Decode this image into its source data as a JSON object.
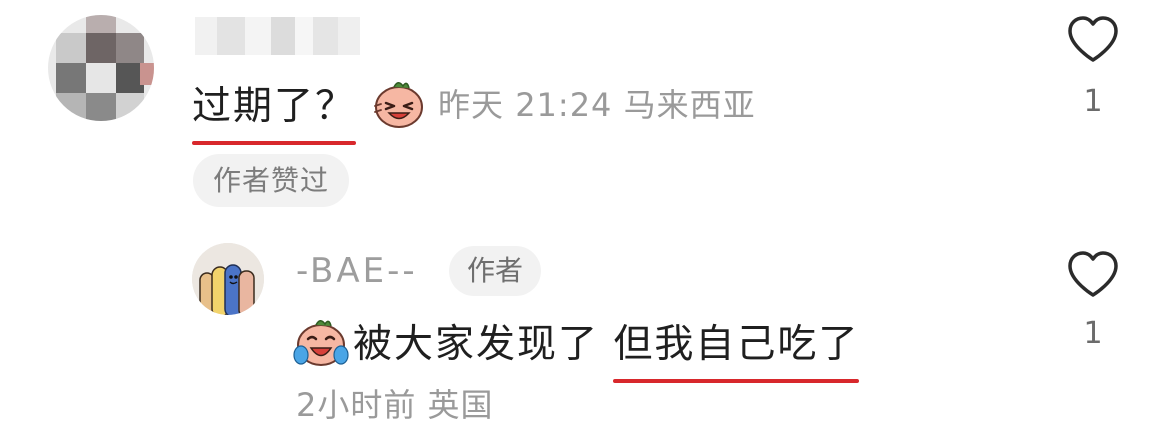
{
  "comment": {
    "text": "过期了？",
    "emoji": "laughing-face-emoji",
    "meta": "昨天 21:24 马来西亚",
    "liked_by_author_badge": "作者赞过",
    "like_count": "1"
  },
  "reply": {
    "username": "-BAE--",
    "author_tag": "作者",
    "emoji": "crying-laughing-face-emoji",
    "text_plain": "被大家发现了 ",
    "text_underlined": "但我自己吃了",
    "meta": "2小时前 英国",
    "like_count": "1"
  },
  "colors": {
    "underline": "#d8282c",
    "meta_text": "#9a9a9a",
    "badge_bg": "#f2f2f2"
  },
  "icons": {
    "like": "heart-outline-icon"
  }
}
